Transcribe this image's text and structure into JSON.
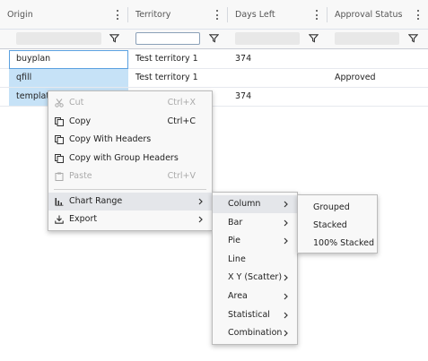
{
  "grid": {
    "columns": [
      {
        "label": "Origin"
      },
      {
        "label": "Territory"
      },
      {
        "label": "Days Left"
      },
      {
        "label": "Approval Status"
      }
    ],
    "rows": [
      {
        "origin": "buyplan",
        "territory": "Test territory 1",
        "days_left": "374",
        "approval_status": ""
      },
      {
        "origin": "qfill",
        "territory": "Test territory 1",
        "days_left": "",
        "approval_status": "Approved"
      },
      {
        "origin": "template",
        "territory": "",
        "days_left": "374",
        "approval_status": ""
      }
    ]
  },
  "context_menu": {
    "items": [
      {
        "label": "Cut",
        "shortcut": "Ctrl+X",
        "icon": "scissors-icon",
        "disabled": true
      },
      {
        "label": "Copy",
        "shortcut": "Ctrl+C",
        "icon": "copy-icon",
        "disabled": false
      },
      {
        "label": "Copy With Headers",
        "shortcut": "",
        "icon": "copy-icon",
        "disabled": false
      },
      {
        "label": "Copy with Group Headers",
        "shortcut": "",
        "icon": "copy-icon",
        "disabled": false
      },
      {
        "label": "Paste",
        "shortcut": "Ctrl+V",
        "icon": "clipboard-icon",
        "disabled": true
      },
      {
        "label": "Chart Range",
        "shortcut": "",
        "icon": "bar-chart-icon",
        "disabled": false
      },
      {
        "label": "Export",
        "shortcut": "",
        "icon": "download-icon",
        "disabled": false
      }
    ]
  },
  "chart_menu": {
    "items": [
      {
        "label": "Column"
      },
      {
        "label": "Bar"
      },
      {
        "label": "Pie"
      },
      {
        "label": "Line"
      },
      {
        "label": "X Y (Scatter)"
      },
      {
        "label": "Area"
      },
      {
        "label": "Statistical"
      },
      {
        "label": "Combination"
      }
    ]
  },
  "column_menu": {
    "items": [
      {
        "label": "Grouped"
      },
      {
        "label": "Stacked"
      },
      {
        "label": "100% Stacked"
      }
    ]
  },
  "colors": {
    "selection": "#c6e2f7",
    "focus_border": "#5aa0e0",
    "menu_bg": "#f8f8f8",
    "menu_highlight": "#e4e6ea"
  }
}
